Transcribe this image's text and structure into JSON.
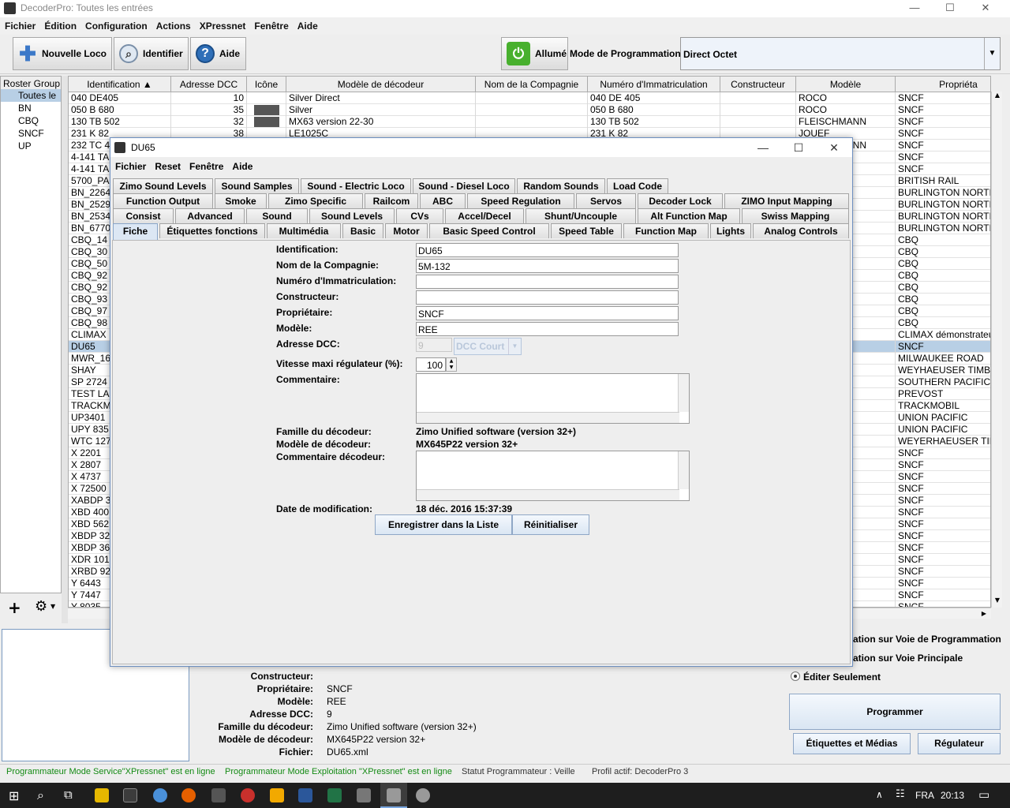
{
  "app": {
    "title": "DecoderPro: Toutes les entrées",
    "menu": [
      "Fichier",
      "Édition",
      "Configuration",
      "Actions",
      "XPressnet",
      "Fenêtre",
      "Aide"
    ]
  },
  "toolbar": {
    "new_loco": "Nouvelle Loco",
    "identify": "Identifier",
    "help": "Aide",
    "power": "Allumé",
    "mode_label": "Mode de Programmation",
    "mode_value": "Direct Octet"
  },
  "roster_groups": {
    "header": "Roster Group",
    "items": [
      "Toutes le",
      "BN",
      "CBQ",
      "SNCF",
      "UP"
    ]
  },
  "table": {
    "columns": [
      "Identification",
      "Adresse DCC",
      "Icône",
      "Modèle de décodeur",
      "Nom de la Compagnie",
      "Numéro d'Immatriculation",
      "Constructeur",
      "Modèle",
      "Propriéta"
    ],
    "rows": [
      [
        "040 DE405",
        "10",
        "",
        "Silver Direct",
        "",
        "040 DE 405",
        "",
        "ROCO",
        "SNCF"
      ],
      [
        "050 B 680",
        "35",
        "img",
        "Silver",
        "",
        "050 B 680",
        "",
        "ROCO",
        "SNCF"
      ],
      [
        "130 TB 502",
        "32",
        "img",
        "MX63 version 22-30",
        "",
        "130 TB 502",
        "",
        "FLEISCHMANN",
        "SNCF"
      ],
      [
        "231 K 82",
        "38",
        "",
        "LE1025C",
        "",
        "231 K 82",
        "",
        "JOUEF",
        "SNCF"
      ],
      [
        "232 TC 4",
        "",
        "",
        "",
        "",
        "",
        "",
        "FLEISCHMANN",
        "SNCF"
      ],
      [
        "4-141 TA",
        "",
        "",
        "",
        "",
        "",
        "",
        "",
        "SNCF"
      ],
      [
        "4-141 TA",
        "",
        "",
        "",
        "",
        "",
        "",
        "",
        "SNCF"
      ],
      [
        "5700_PA",
        "",
        "",
        "",
        "",
        "",
        "",
        "",
        "BRITISH RAIL"
      ],
      [
        "BN_2264",
        "",
        "",
        "",
        "",
        "",
        "",
        "",
        "BURLINGTON NORTH"
      ],
      [
        "BN_2529",
        "",
        "",
        "",
        "",
        "",
        "",
        "",
        "BURLINGTON NORTH"
      ],
      [
        "BN_2534",
        "",
        "",
        "",
        "",
        "",
        "",
        "",
        "BURLINGTON NORTH"
      ],
      [
        "BN_6770",
        "",
        "",
        "",
        "",
        "",
        "",
        "",
        "BURLINGTON NORTH"
      ],
      [
        "CBQ_14",
        "",
        "",
        "",
        "",
        "",
        "",
        "",
        "CBQ"
      ],
      [
        "CBQ_30",
        "",
        "",
        "",
        "",
        "",
        "",
        "",
        "CBQ"
      ],
      [
        "CBQ_50",
        "",
        "",
        "",
        "",
        "",
        "",
        "",
        "CBQ"
      ],
      [
        "CBQ_92",
        "",
        "",
        "",
        "",
        "",
        "",
        "",
        "CBQ"
      ],
      [
        "CBQ_92",
        "",
        "",
        "",
        "",
        "",
        "",
        "",
        "CBQ"
      ],
      [
        "CBQ_93",
        "",
        "",
        "",
        "",
        "",
        "",
        "OBBIES",
        "CBQ"
      ],
      [
        "CBQ_97",
        "",
        "",
        "",
        "",
        "",
        "",
        "",
        "CBQ"
      ],
      [
        "CBQ_98",
        "",
        "",
        "",
        "",
        "",
        "",
        "",
        "CBQ"
      ],
      [
        "CLIMAX",
        "",
        "",
        "",
        "",
        "",
        "",
        "",
        "CLIMAX démonstrateu"
      ],
      [
        "DU65",
        "",
        "",
        "",
        "",
        "",
        "",
        "",
        "SNCF"
      ],
      [
        "MWR_16",
        "",
        "",
        "",
        "",
        "",
        "",
        "",
        "MILWAUKEE ROAD"
      ],
      [
        "SHAY",
        "",
        "",
        "",
        "",
        "",
        "",
        "",
        "WEYHAEUSER TIMBE"
      ],
      [
        "SP 2724",
        "",
        "",
        "",
        "",
        "",
        "",
        "ENESIS",
        "SOUTHERN PACIFIC"
      ],
      [
        "TEST LA",
        "",
        "",
        "",
        "",
        "",
        "",
        "",
        "PREVOST"
      ],
      [
        "TRACKM",
        "",
        "",
        "",
        "",
        "",
        "",
        "",
        "TRACKMOBIL"
      ],
      [
        "UP3401",
        "",
        "",
        "",
        "",
        "",
        "",
        "",
        "UNION PACIFIC"
      ],
      [
        "UPY 835",
        "",
        "",
        "",
        "",
        "",
        "",
        "",
        "UNION PACIFIC"
      ],
      [
        "WTC 127",
        "",
        "",
        "",
        "",
        "",
        "",
        "ER",
        "WEYERHAEUSER TIM"
      ],
      [
        "X 2201",
        "",
        "",
        "",
        "",
        "",
        "",
        "",
        "SNCF"
      ],
      [
        "X 2807",
        "",
        "",
        "",
        "",
        "",
        "",
        "",
        "SNCF"
      ],
      [
        "X 4737",
        "",
        "",
        "",
        "",
        "",
        "",
        "",
        "SNCF"
      ],
      [
        "X 72500",
        "",
        "",
        "",
        "",
        "",
        "",
        "UEF",
        "SNCF"
      ],
      [
        "XABDP 3",
        "",
        "",
        "",
        "",
        "",
        "",
        "EN",
        "SNCF"
      ],
      [
        "XBD 400",
        "",
        "",
        "",
        "",
        "",
        "",
        "",
        "SNCF"
      ],
      [
        "XBD 562",
        "",
        "",
        "",
        "",
        "",
        "",
        "",
        "SNCF"
      ],
      [
        "XBDP 32",
        "",
        "",
        "",
        "",
        "",
        "",
        "EN",
        "SNCF"
      ],
      [
        "XBDP 36",
        "",
        "",
        "",
        "",
        "",
        "",
        "EN",
        "SNCF"
      ],
      [
        "XDR 101",
        "",
        "",
        "",
        "",
        "",
        "",
        "",
        "SNCF"
      ],
      [
        "XRBD 92",
        "",
        "",
        "",
        "",
        "",
        "",
        "",
        "SNCF"
      ],
      [
        "Y 6443",
        "",
        "",
        "",
        "",
        "",
        "",
        "",
        "SNCF"
      ],
      [
        "Y 7447",
        "",
        "",
        "",
        "",
        "",
        "",
        "",
        "SNCF"
      ],
      [
        "Y 8035",
        "",
        "",
        "",
        "",
        "",
        "",
        "",
        "SNCF"
      ]
    ],
    "selected_row": 21
  },
  "details": {
    "rows": [
      {
        "k": "Constructeur:",
        "v": ""
      },
      {
        "k": "Propriétaire:",
        "v": "SNCF"
      },
      {
        "k": "Modèle:",
        "v": "REE"
      },
      {
        "k": "Adresse DCC:",
        "v": "9"
      },
      {
        "k": "Famille du décodeur:",
        "v": "Zimo Unified software (version 32+)"
      },
      {
        "k": "Modèle de décodeur:",
        "v": "MX645P22 version 32+"
      },
      {
        "k": "Fichier:",
        "v": "DU65.xml"
      }
    ]
  },
  "right_panel": {
    "opt1": "ation sur Voie de Programmation",
    "opt2": "ation sur Voie Principale",
    "opt3": "Éditer Seulement",
    "program": "Programmer",
    "labels_media": "Étiquettes et Médias",
    "throttle": "Régulateur"
  },
  "status": {
    "s1": "Programmateur Mode Service\"XPressnet\" est en ligne",
    "s2": "Programmateur Mode Exploitation \"XPressnet\" est en ligne",
    "s3": "Statut Programmateur : Veille",
    "s4": "Profil actif: DecoderPro 3",
    "online_color": "#138a13"
  },
  "taskbar": {
    "lang": "FRA",
    "time": "20:13"
  },
  "dialog": {
    "title": "DU65",
    "menu": [
      "Fichier",
      "Reset",
      "Fenêtre",
      "Aide"
    ],
    "tab_rows": [
      [
        "Zimo Sound Levels",
        "Sound Samples",
        "Sound - Electric Loco",
        "Sound - Diesel Loco",
        "Random Sounds",
        "Load Code"
      ],
      [
        "Function Output",
        "Smoke",
        "Zimo Specific",
        "Railcom",
        "ABC",
        "Speed Regulation",
        "Servos",
        "Decoder Lock",
        "ZIMO Input Mapping"
      ],
      [
        "Consist",
        "Advanced",
        "Sound",
        "Sound Levels",
        "CVs",
        "Accel/Decel",
        "Shunt/Uncouple",
        "Alt Function Map",
        "Swiss Mapping"
      ],
      [
        "Fiche",
        "Étiquettes fonctions",
        "Multimédia",
        "Basic",
        "Motor",
        "Basic Speed Control",
        "Speed Table",
        "Function Map",
        "Lights",
        "Analog Controls"
      ]
    ],
    "form": {
      "id_label": "Identification:",
      "id_value": "DU65",
      "company_label": "Nom de la Compagnie:",
      "company_value": "5M-132",
      "reg_label": "Numéro d'Immatriculation:",
      "reg_value": "",
      "builder_label": "Constructeur:",
      "builder_value": "",
      "owner_label": "Propriétaire:",
      "owner_value": "SNCF",
      "model_label": "Modèle:",
      "model_value": "REE",
      "dcc_label": "Adresse DCC:",
      "dcc_value": "9",
      "dcc_type": "DCC Court",
      "speed_label": "Vitesse maxi régulateur (%):",
      "speed_value": "100",
      "comment_label": "Commentaire:",
      "family_label": "Famille du décodeur:",
      "family_value": "Zimo Unified software (version 32+)",
      "decoder_model_label": "Modèle de décodeur:",
      "decoder_model_value": "MX645P22 version 32+",
      "decoder_comment_label": "Commentaire décodeur:",
      "date_label": "Date de modification:",
      "date_value": "18 déc. 2016 15:37:39",
      "save_btn": "Enregistrer dans la Liste",
      "reset_btn": "Réinitialiser"
    }
  }
}
